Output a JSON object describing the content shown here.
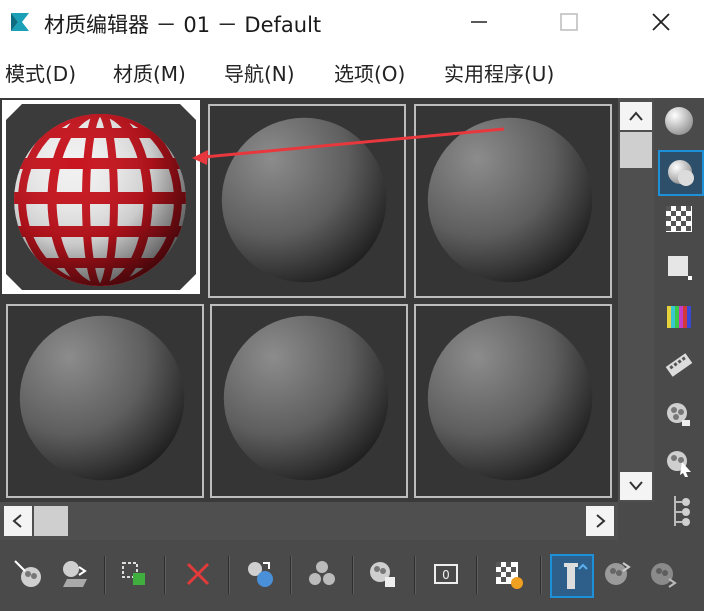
{
  "window": {
    "title": "材质编辑器 － 01 － Default",
    "controls": [
      "minimize",
      "maximize",
      "close"
    ]
  },
  "menu": [
    {
      "label": "模式(D)"
    },
    {
      "label": "材质(M)"
    },
    {
      "label": "导航(N)"
    },
    {
      "label": "选项(O)"
    },
    {
      "label": "实用程序(U)"
    }
  ],
  "sample_slots": [
    {
      "material": "01 - Default",
      "appearance": "red-white-checker",
      "active": true
    },
    {
      "appearance": "gray"
    },
    {
      "appearance": "gray"
    },
    {
      "appearance": "gray"
    },
    {
      "appearance": "gray"
    },
    {
      "appearance": "gray"
    }
  ],
  "sidebar_icons": [
    "sample-type-sphere-icon",
    "backlight-icon",
    "background-checker-icon",
    "uv-tiling-icon",
    "video-color-check-icon",
    "make-preview-icon",
    "sample-options-icon",
    "select-by-material-icon",
    "material-map-navigator-icon"
  ],
  "toolbar_icons": [
    "get-material-icon",
    "put-to-scene-icon",
    "assign-to-selection-icon",
    "reset-map-icon",
    "make-unique-icon",
    "put-to-library-icon",
    "material-id-channel-icon",
    "show-map-in-viewport-icon",
    "show-end-result-icon",
    "go-to-parent-icon",
    "go-forward-to-sibling-icon"
  ],
  "colors": {
    "accent": "#1e90d8",
    "panel": "#4a4a4a",
    "annotation_arrow": "#e8383d",
    "highlight_material": "#c8141e"
  }
}
